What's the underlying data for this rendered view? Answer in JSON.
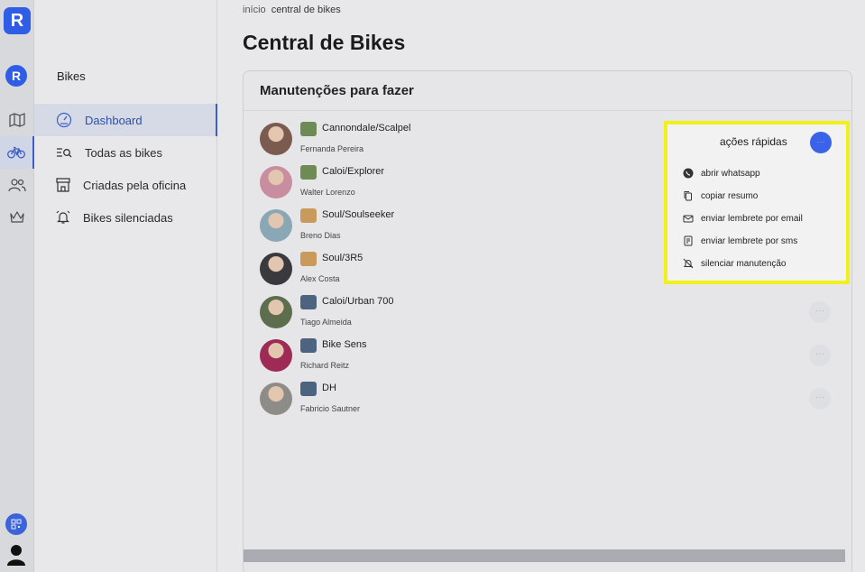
{
  "rail": {
    "logo": "R",
    "logo2": "R",
    "icons": [
      "map-icon",
      "bike-icon",
      "users-icon",
      "crown-icon"
    ]
  },
  "sidebar": {
    "title": "Bikes",
    "items": [
      {
        "label": "Dashboard",
        "icon": "gauge-icon",
        "active": true
      },
      {
        "label": "Todas as bikes",
        "icon": "list-search-icon",
        "active": false
      },
      {
        "label": "Criadas pela oficina",
        "icon": "store-icon",
        "active": false
      },
      {
        "label": "Bikes silenciadas",
        "icon": "bell-icon",
        "active": false
      }
    ]
  },
  "breadcrumb": {
    "home": "início",
    "current": "central de bikes"
  },
  "page": {
    "title": "Central de Bikes"
  },
  "card": {
    "title": "Manutenções para fazer",
    "rows": [
      {
        "bike": "Cannondale/Scalpel",
        "owner": "Fernanda Pereira",
        "badge_color": "#6e8a55",
        "avatar_color": "#7b5b4f"
      },
      {
        "bike": "Caloi/Explorer",
        "owner": "Walter Lorenzo",
        "badge_color": "#6e8a55",
        "avatar_color": "#c98da0"
      },
      {
        "bike": "Soul/Soulseeker",
        "owner": "Breno Dias",
        "badge_color": "#c99a5c",
        "avatar_color": "#8aa7b5"
      },
      {
        "bike": "Soul/3R5",
        "owner": "Alex Costa",
        "badge_color": "#c99a5c",
        "avatar_color": "#3a3a3e"
      },
      {
        "bike": "Caloi/Urban 700",
        "owner": "Tiago Almeida",
        "badge_color": "#4c6480",
        "avatar_color": "#5c6e4d"
      },
      {
        "bike": "Bike Sens",
        "owner": "Richard Reitz",
        "badge_color": "#4c6480",
        "avatar_color": "#9e2b55"
      },
      {
        "bike": "DH",
        "owner": "Fabricio Sautner",
        "badge_color": "#4c6480",
        "avatar_color": "#8d8c88"
      }
    ],
    "more_label": "···"
  },
  "popup": {
    "title": "ações rápidas",
    "button": "···",
    "items": [
      {
        "label": "abrir whatsapp",
        "icon": "whatsapp-icon"
      },
      {
        "label": "copiar resumo",
        "icon": "copy-icon"
      },
      {
        "label": "enviar lembrete por email",
        "icon": "mail-icon"
      },
      {
        "label": "enviar lembrete por sms",
        "icon": "sms-icon"
      },
      {
        "label": "silenciar manutenção",
        "icon": "bell-off-icon"
      }
    ]
  }
}
